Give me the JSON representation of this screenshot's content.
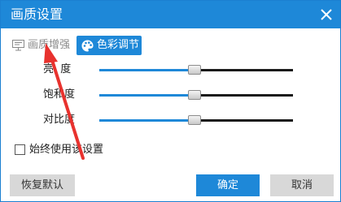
{
  "window": {
    "title": "画质设置",
    "close_icon": "close-icon"
  },
  "tabs": [
    {
      "label": "画质增强",
      "icon": "monitor-icon",
      "active": false
    },
    {
      "label": "色彩调节",
      "icon": "palette-icon",
      "active": true
    }
  ],
  "sliders": [
    {
      "label": "亮  度",
      "value_fraction": 0.49
    },
    {
      "label": "饱和度",
      "value_fraction": 0.49
    },
    {
      "label": "对比度",
      "value_fraction": 0.49
    }
  ],
  "checkbox": {
    "label": "始终使用该设置",
    "checked": false
  },
  "buttons": {
    "reset": "恢复默认",
    "ok": "确定",
    "cancel": "取消"
  },
  "colors": {
    "accent": "#1e88d8",
    "annotation_arrow": "#e8322e"
  }
}
